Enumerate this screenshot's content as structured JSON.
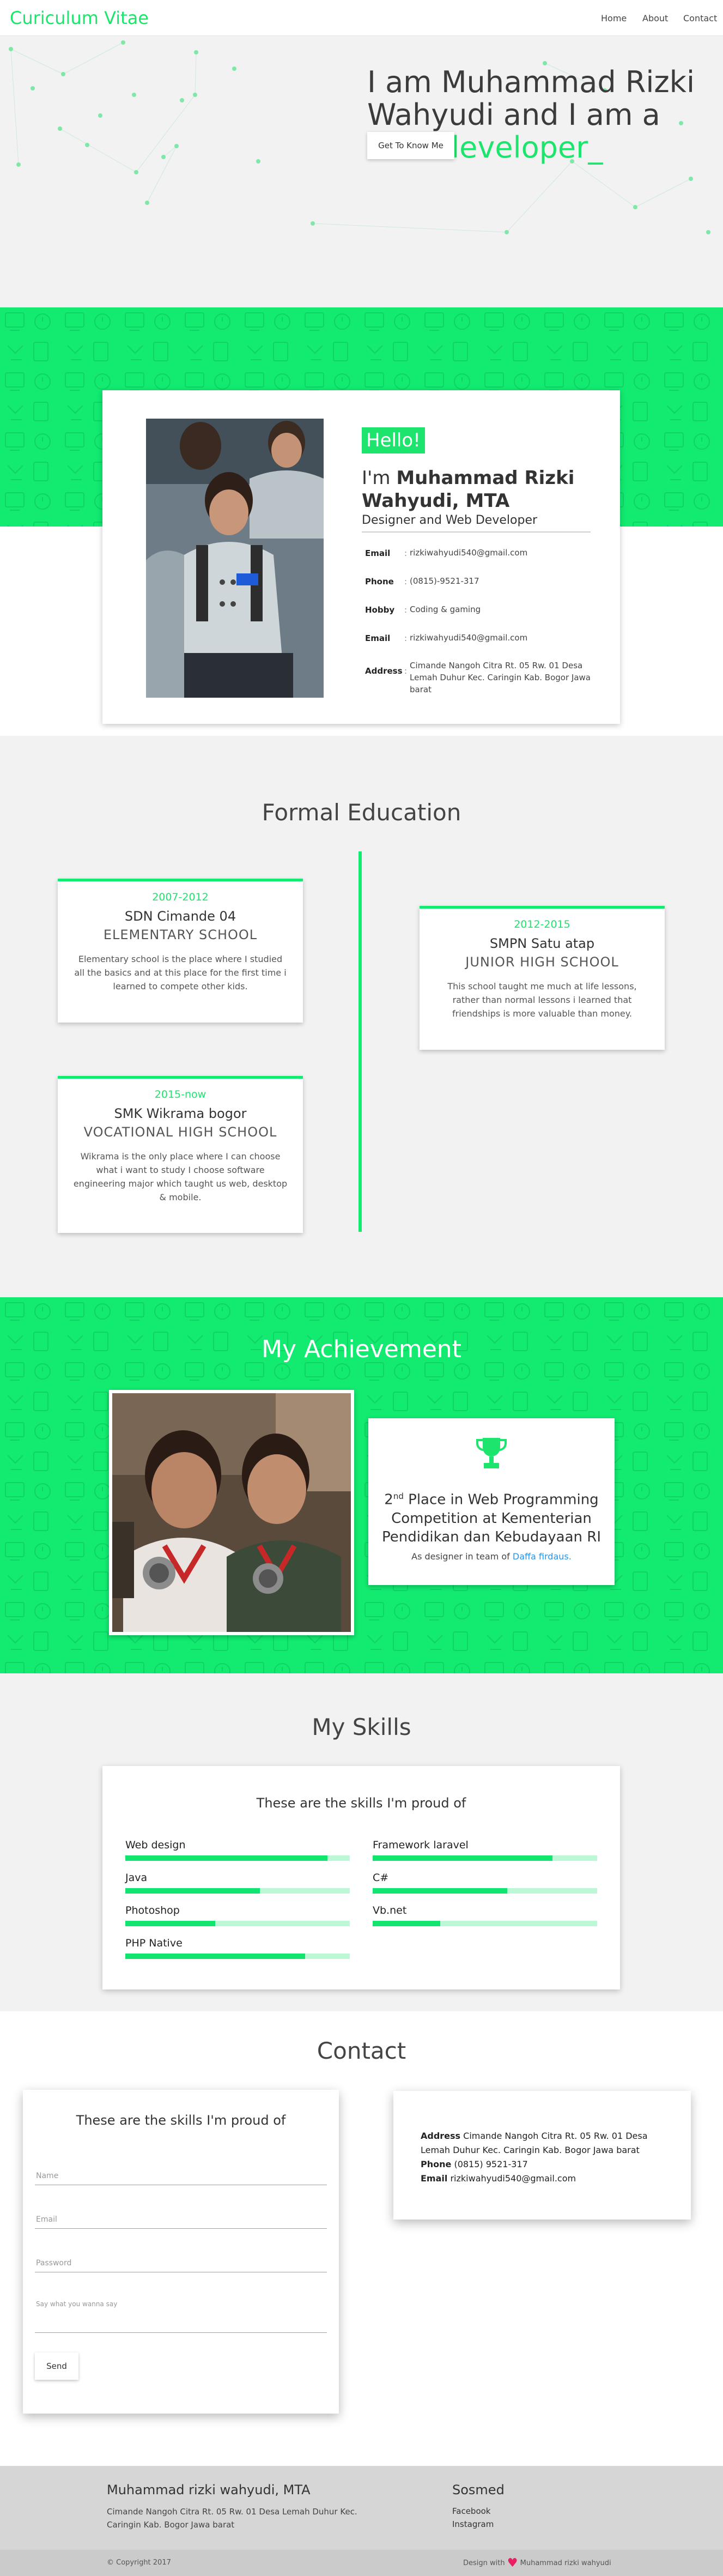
{
  "nav": {
    "brand": "Curiculum Vitae",
    "links": [
      "Home",
      "About",
      "Contact"
    ]
  },
  "hero": {
    "title_line1": "I am Muhammad Rizki",
    "title_line2": "Wahyudi and I am a",
    "title_accent": "Web developer_",
    "button": "Get To Know Me"
  },
  "profile": {
    "hello": "Hello!",
    "name_prefix": "I'm ",
    "name": "Muhammad Rizki Wahyudi, MTA",
    "role": "Designer and Web Developer",
    "info": [
      {
        "label": "Email",
        "sep": ":",
        "value": "rizkiwahyudi540@gmail.com"
      },
      {
        "label": "Phone",
        "sep": ":",
        "value": "(0815)-9521-317"
      },
      {
        "label": "Hobby",
        "sep": ":",
        "value": "Coding & gaming"
      },
      {
        "label": "Email",
        "sep": ":",
        "value": "rizkiwahyudi540@gmail.com"
      },
      {
        "label": "Address",
        "sep": ":",
        "value": "Cimande Nangoh Citra Rt. 05 Rw. 01 Desa Lemah Duhur Kec. Caringin Kab. Bogor Jawa barat"
      }
    ]
  },
  "education": {
    "title": "Formal Education",
    "items": [
      {
        "year": "2007-2012",
        "school": "SDN Cimande 04",
        "level": "ELEMENTARY SCHOOL",
        "desc": "Elementary school is the place where I studied all the basics and at this place for the first time i learned to compete other kids."
      },
      {
        "year": "2012-2015",
        "school": "SMPN Satu atap",
        "level": "JUNIOR HIGH SCHOOL",
        "desc": "This school taught me much at life lessons, rather than normal lessons i learned that friendships is more valuable than money."
      },
      {
        "year": "2015-now",
        "school": "SMK Wikrama bogor",
        "level": "VOCATIONAL HIGH SCHOOL",
        "desc": "Wikrama is the only place where I can choose what i want to study I choose software engineering major which taught us web, desktop & mobile."
      }
    ]
  },
  "achievement": {
    "title": "My Achievement",
    "place_num": "2",
    "place_sup": "nd",
    "text": " Place in Web Programming Competition at Kementerian Pendidikan dan Kebudayaan RI",
    "team_prefix": "As designer in team of ",
    "team_link": "Daffa firdaus."
  },
  "skills": {
    "title": "My Skills",
    "heading": "These are the skills I'm proud of",
    "items": [
      {
        "name": "Web design",
        "level": 0.9
      },
      {
        "name": "Framework laravel",
        "level": 0.8
      },
      {
        "name": "Java",
        "level": 0.6
      },
      {
        "name": "C#",
        "level": 0.6
      },
      {
        "name": "Photoshop",
        "level": 0.4
      },
      {
        "name": "Vb.net",
        "level": 0.3
      },
      {
        "name": "PHP Native",
        "level": 0.8
      }
    ]
  },
  "contact": {
    "title": "Contact",
    "form_heading": "These are the skills I'm proud of",
    "placeholders": {
      "name": "Name",
      "email": "Email",
      "password": "Password",
      "message": "Say what you wanna say"
    },
    "send": "Send",
    "address_label": "Address",
    "address": "Cimande Nangoh Citra Rt. 05 Rw. 01 Desa Lemah Duhur Kec. Caringin Kab. Bogor Jawa barat",
    "phone_label": "Phone",
    "phone": "(0815) 9521-317",
    "email_label": "Email",
    "email": "rizkiwahyudi540@gmail.com"
  },
  "footer": {
    "name": "Muhammad rizki wahyudi, MTA",
    "address": "Cimande Nangoh Citra Rt. 05 Rw. 01 Desa Lemah Duhur Kec. Caringin Kab. Bogor Jawa barat",
    "social_title": "Sosmed",
    "social_links": [
      "Facebook",
      "Instagram"
    ],
    "copyright": "© Copyright 2017",
    "made_prefix": "Design with",
    "made_suffix": "Muhammad rizki wahyudi"
  },
  "colors": {
    "accent": "#1de46c",
    "band": "#12ea70",
    "link": "#2196f3",
    "heart": "#e91e63"
  }
}
